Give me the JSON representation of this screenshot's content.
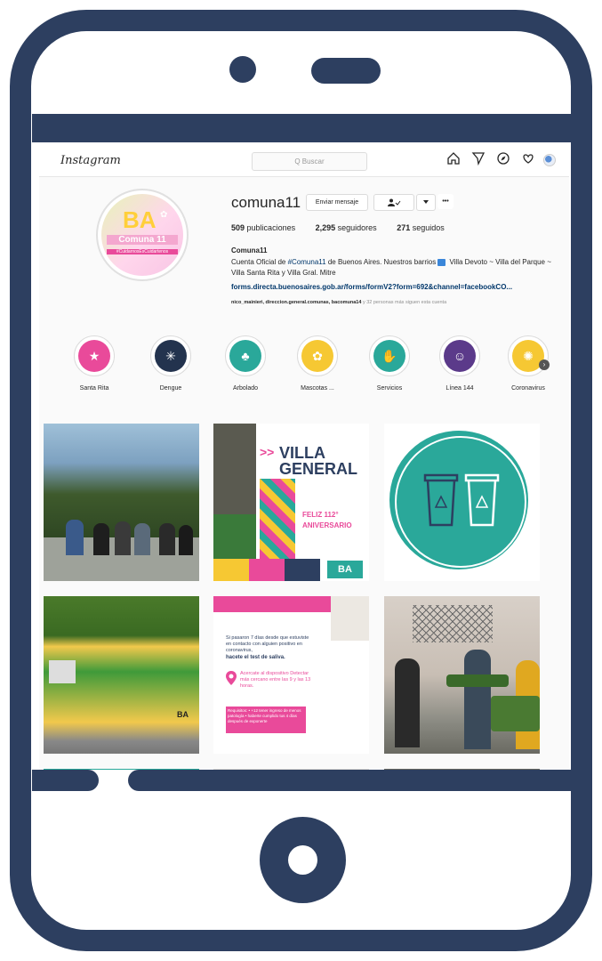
{
  "app": {
    "logo": "Instagram",
    "search_placeholder": "Q Buscar"
  },
  "profile": {
    "username": "comuna11",
    "message_button": "Enviar mensaje",
    "follow_icon": "person-check-icon",
    "more_label": "•••",
    "posts": "509",
    "posts_label": "publicaciones",
    "followers": "2,295",
    "followers_label": "seguidores",
    "following": "271",
    "following_label": "seguidos",
    "bio_name": "Comuna11",
    "bio_line1_a": "Cuenta Oficial de ",
    "bio_line1_hash": "#Comuna11",
    "bio_line1_b": " de Buenos Aires. Nuestros barrios",
    "bio_line1_c": " Villa Devoto ~ Villa del Parque ~ Villa Santa Rita y Villa Gral. Mitre",
    "bio_link": "forms.directa.buenosaires.gob.ar/forms/formV2?form=692&channel=facebookCO...",
    "followed_by_names": "nico_mainieri, direccion.general.comunas, bacomuna14",
    "followed_by_rest": "y 32 personas más siguen esta cuenta",
    "avatar_ba": "BA",
    "avatar_comuna": "Comuna 11",
    "avatar_hash": "#CuidarnosEsCuidartenos"
  },
  "highlights": [
    {
      "label": "Santa Rita",
      "color": "#e94a9a",
      "icon": "santa-rita-icon"
    },
    {
      "label": "Dengue",
      "color": "#23334e",
      "icon": "mosquito-icon"
    },
    {
      "label": "Arbolado",
      "color": "#2aa89a",
      "icon": "tree-icon"
    },
    {
      "label": "Mascotas ...",
      "color": "#f6c833",
      "icon": "pet-icon"
    },
    {
      "label": "Servicios",
      "color": "#2aa89a",
      "icon": "handshake-icon"
    },
    {
      "label": "Línea 144",
      "color": "#5b3a8a",
      "icon": "people-icon"
    },
    {
      "label": "Coronavirus",
      "color": "#f6c833",
      "icon": "virus-icon"
    }
  ],
  "posts": {
    "villa_general": "VILLA GENERAL",
    "villa_general_prefix": ">>",
    "feliz": "FELIZ 112°",
    "aniversario": "ANIVERSARIO",
    "ba": "BA",
    "saliva_text": "Si pasaron 7 días desde que estuviste en contacto con alguien positivo en coronavirus,",
    "saliva_bold": "hacete el test de saliva.",
    "acercate": "Acercate al dispositivo Detectar más cercano entre las 9 y las 13 horas.",
    "requisitos": "Requisitos: • +12 tener ingreso de menos patología • haberte cumplido tus 4 días después de exponerte"
  },
  "colors": {
    "frame": "#2d3f60",
    "teal": "#2aa89a",
    "pink": "#e94a9a",
    "yellow": "#f6c833"
  }
}
